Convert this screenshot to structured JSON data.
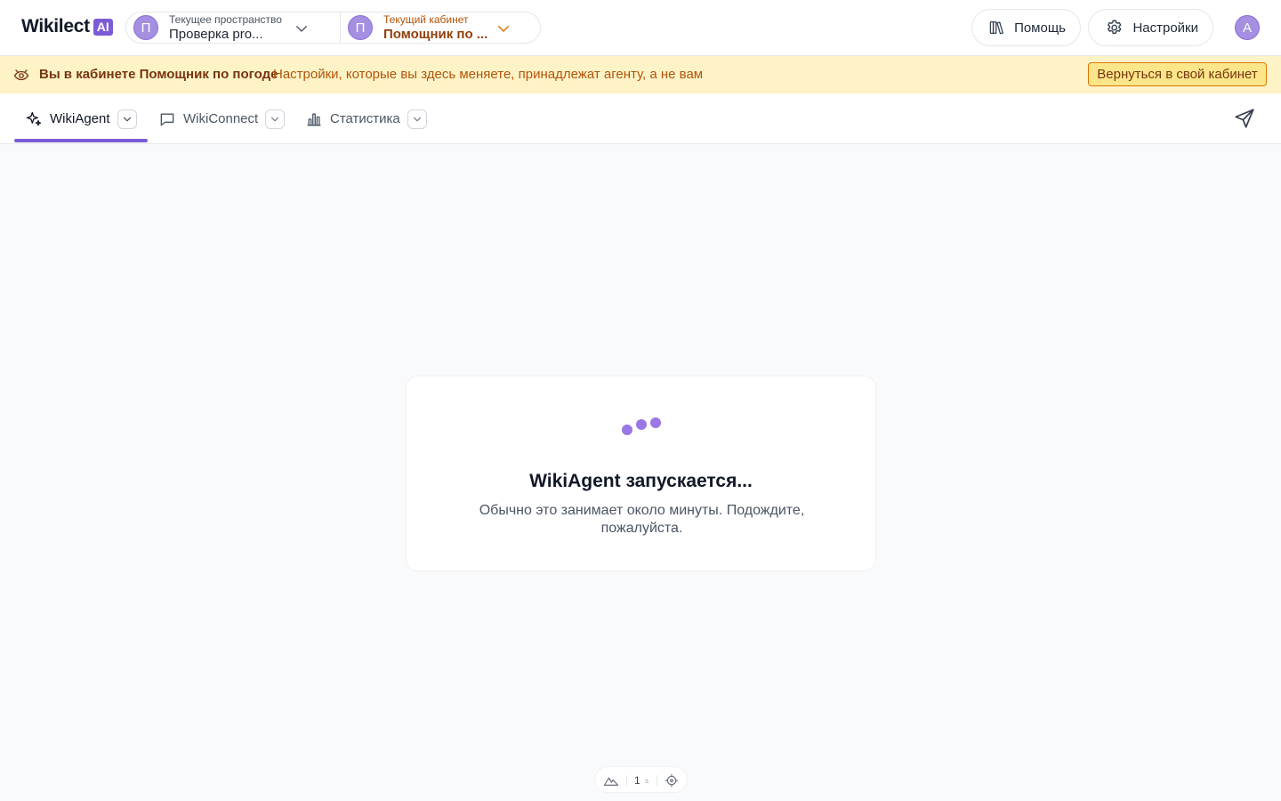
{
  "header": {
    "logo_text": "Wikilect",
    "logo_badge": "AI",
    "workspace": {
      "caption": "Текущее пространство",
      "value": "Проверка pro...",
      "avatar_letter": "П"
    },
    "cabinet": {
      "caption": "Текущий кабинет",
      "value": "Помощник по ...",
      "avatar_letter": "П"
    },
    "help_label": "Помощь",
    "settings_label": "Настройки",
    "user_avatar_letter": "А"
  },
  "banner": {
    "title": "Вы в кабинете Помощник по погоде",
    "text": "Настройки, которые вы здесь меняете, принадлежат агенту, а не вам",
    "button_label": "Вернуться в свой кабинет"
  },
  "tabs": [
    {
      "label": "WikiAgent",
      "icon": "sparkle-icon",
      "active": true
    },
    {
      "label": "WikiConnect",
      "icon": "chat-bubble-icon",
      "active": false
    },
    {
      "label": "Статистика",
      "icon": "bar-chart-icon",
      "active": false
    }
  ],
  "card": {
    "title": "WikiAgent запускается...",
    "subtitle": "Обычно это занимает около минуты. Подождите, пожалуйста."
  },
  "status_pill": {
    "count": "1",
    "unit": "s"
  },
  "colors": {
    "accent": "#7c5cd6",
    "banner_bg": "#fef3c7",
    "banner_title": "#78350f",
    "banner_text": "#b45309",
    "page_bg": "#f9fafb"
  }
}
